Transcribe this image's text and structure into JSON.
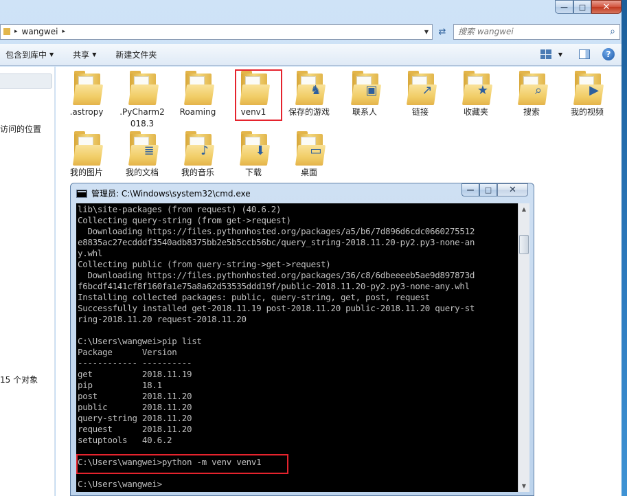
{
  "explorer": {
    "caption_buttons": {
      "minimize": "—",
      "maximize": "□",
      "close": "✕"
    },
    "address": {
      "path": [
        "wangwei"
      ],
      "separator": "▸"
    },
    "search": {
      "placeholder": "搜索 wangwei"
    },
    "toolbar": {
      "include_library": "包含到库中",
      "share": "共享",
      "new_folder": "新建文件夹"
    },
    "nav": {
      "recent_places": "访问的位置"
    },
    "status": {
      "count": "15 个对象"
    },
    "items": [
      {
        "label": ".astropy",
        "emblem": ""
      },
      {
        "label": ".PyCharm2018.3",
        "emblem": ""
      },
      {
        "label": "Roaming",
        "emblem": ""
      },
      {
        "label": "venv1",
        "emblem": ""
      },
      {
        "label": "保存的游戏",
        "emblem": "♞"
      },
      {
        "label": "联系人",
        "emblem": "▣"
      },
      {
        "label": "链接",
        "emblem": "↗"
      },
      {
        "label": "收藏夹",
        "emblem": "★"
      },
      {
        "label": "搜索",
        "emblem": "⌕"
      },
      {
        "label": "我的视频",
        "emblem": "▶"
      },
      {
        "label": "我的图片",
        "emblem": ""
      },
      {
        "label": "我的文档",
        "emblem": "≣"
      },
      {
        "label": "我的音乐",
        "emblem": "♪"
      },
      {
        "label": "下载",
        "emblem": "⬇"
      },
      {
        "label": "桌面",
        "emblem": "▭"
      }
    ]
  },
  "cmd": {
    "title": "管理员: C:\\Windows\\system32\\cmd.exe",
    "caption_buttons": {
      "minimize": "—",
      "maximize": "□",
      "close": "✕"
    },
    "scroll": {
      "up": "▲",
      "down": "▼"
    },
    "output": "lib\\site-packages (from request) (40.6.2)\nCollecting query-string (from get->request)\n  Downloading https://files.pythonhosted.org/packages/a5/b6/7d896d6cdc0660275512\ne8835ac27ecdddf3540adb8375bb2e5b5ccb56bc/query_string-2018.11.20-py2.py3-none-an\ny.whl\nCollecting public (from query-string->get->request)\n  Downloading https://files.pythonhosted.org/packages/36/c8/6dbeeeeb5ae9d897873d\nf6bcdf4141cf8f160fa1e75a8a62d53535ddd19f/public-2018.11.20-py2.py3-none-any.whl\nInstalling collected packages: public, query-string, get, post, request\nSuccessfully installed get-2018.11.19 post-2018.11.20 public-2018.11.20 query-st\nring-2018.11.20 request-2018.11.20\n\nC:\\Users\\wangwei>pip list\nPackage      Version\n------------ ----------\nget          2018.11.19\npip          18.1\npost         2018.11.20\npublic       2018.11.20\nquery-string 2018.11.20\nrequest      2018.11.20\nsetuptools   40.6.2\n\nC:\\Users\\wangwei>python -m venv venv1\n\nC:\\Users\\wangwei>"
  }
}
